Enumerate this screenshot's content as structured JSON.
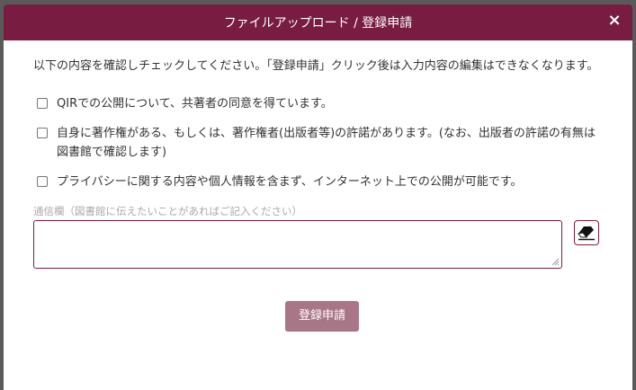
{
  "dialog": {
    "title": "ファイルアップロード / 登録申請",
    "close_symbol": "×"
  },
  "intro": "以下の内容を確認しチェックしてください。「登録申請」クリック後は入力内容の編集はできなくなります。",
  "checks": [
    {
      "label": "QIRでの公開について、共著者の同意を得ています。",
      "checked": false
    },
    {
      "label": "自身に著作権がある、もしくは、著作権者(出版者等)の許諾があります。(なお、出版者の許諾の有無は図書館で確認します)",
      "checked": false
    },
    {
      "label": "プライバシーに関する内容や個人情報を含まず、インターネット上での公開が可能です。",
      "checked": false
    }
  ],
  "memo": {
    "label": "通信欄（図書館に伝えたいことがあればご記入ください）",
    "value": ""
  },
  "icons": {
    "close": "close-icon",
    "clear": "eraser-icon"
  },
  "submit_label": "登録申請",
  "colors": {
    "header": "#781c42",
    "accent_border": "#7a1c42",
    "submit_disabled": "#a87686"
  }
}
